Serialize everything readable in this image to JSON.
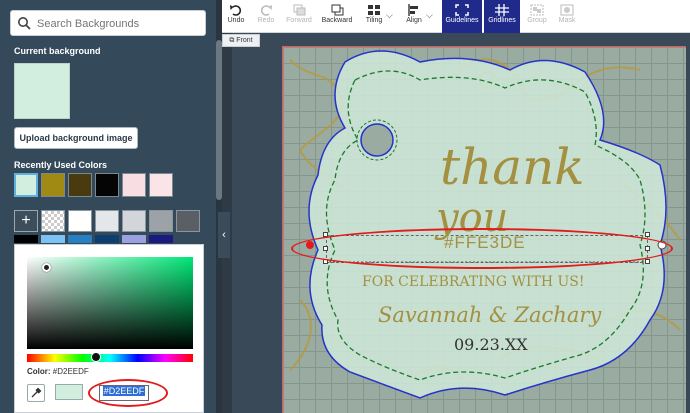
{
  "search": {
    "placeholder": "Search Backgrounds"
  },
  "current_background": {
    "label": "Current background",
    "color": "#D2EEDF"
  },
  "upload_button": {
    "label": "Upload background image"
  },
  "recent": {
    "label": "Recently Used Colors",
    "colors": [
      "#d2eedf",
      "#a08a14",
      "#4a3a10",
      "#050505",
      "#f8dde2",
      "#fbe4e8"
    ]
  },
  "palette": {
    "add_label": "+",
    "colors": [
      "#ffffff",
      "#e4e7ea",
      "#d2d6da",
      "#9ca2a8",
      "#5a5f66"
    ]
  },
  "palette_row2": {
    "colors": [
      "#000000",
      "#7cc3f2",
      "#2580c4",
      "#0c3e70",
      "#9aa0e0",
      "#1a1a80"
    ]
  },
  "picker": {
    "color_label": "Color:",
    "color_value": "#D2EEDF",
    "hex_value": "#D2EEDF",
    "preview_color": "#d2eedf"
  },
  "toolbar": {
    "undo": "Undo",
    "redo": "Redo",
    "forward": "Forward",
    "backward": "Backward",
    "tiling": "Tiling",
    "align": "Align",
    "guidelines": "Guidelines",
    "gridlines": "Gridlines",
    "group": "Group",
    "mask": "Mask"
  },
  "front_tab": "Front",
  "card": {
    "thank": "thank",
    "you": "you",
    "hex_text": "#FFE3DE",
    "celebrate": "FOR CELEBRATING WITH US!",
    "names": "Savannah & Zachary",
    "date": "09.23.XX"
  }
}
